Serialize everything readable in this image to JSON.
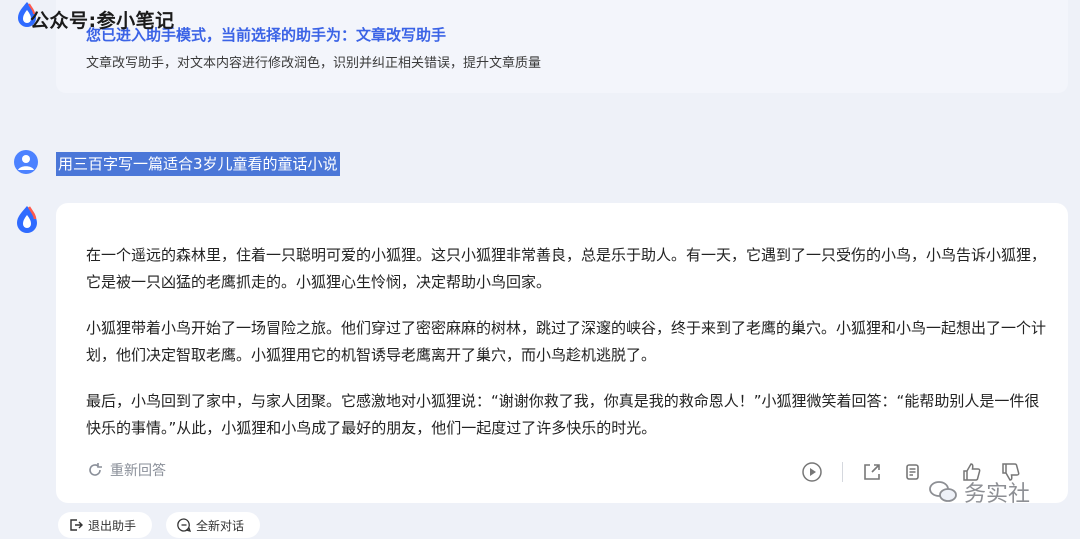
{
  "watermark_top": "公众号:参小笔记",
  "system_card": {
    "title": "您已进入助手模式，当前选择的助手为：文章改写助手",
    "description": "文章改写助手，对文本内容进行修改润色，识别并纠正相关错误，提升文章质量"
  },
  "user_message": "用三百字写一篇适合3岁儿童看的童话小说",
  "answer": {
    "paragraphs": [
      "在一个遥远的森林里，住着一只聪明可爱的小狐狸。这只小狐狸非常善良，总是乐于助人。有一天，它遇到了一只受伤的小鸟，小鸟告诉小狐狸，它是被一只凶猛的老鹰抓走的。小狐狸心生怜悯，决定帮助小鸟回家。",
      "小狐狸带着小鸟开始了一场冒险之旅。他们穿过了密密麻麻的树林，跳过了深邃的峡谷，终于来到了老鹰的巢穴。小狐狸和小鸟一起想出了一个计划，他们决定智取老鹰。小狐狸用它的机智诱导老鹰离开了巢穴，而小鸟趁机逃脱了。",
      "最后，小鸟回到了家中，与家人团聚。它感激地对小狐狸说：“谢谢你救了我，你真是我的救命恩人！”小狐狸微笑着回答：“能帮助别人是一件很快乐的事情。”从此，小狐狸和小鸟成了最好的朋友，他们一起度过了许多快乐的时光。"
    ],
    "regenerate_label": "重新回答"
  },
  "bottom": {
    "exit_label": "退出助手",
    "new_chat_label": "全新对话"
  },
  "brand_watermark": "务实社",
  "icons": {
    "play": "play-icon",
    "share": "share-icon",
    "copy": "copy-icon",
    "like": "thumbs-up-icon",
    "dislike": "thumbs-down-icon"
  }
}
